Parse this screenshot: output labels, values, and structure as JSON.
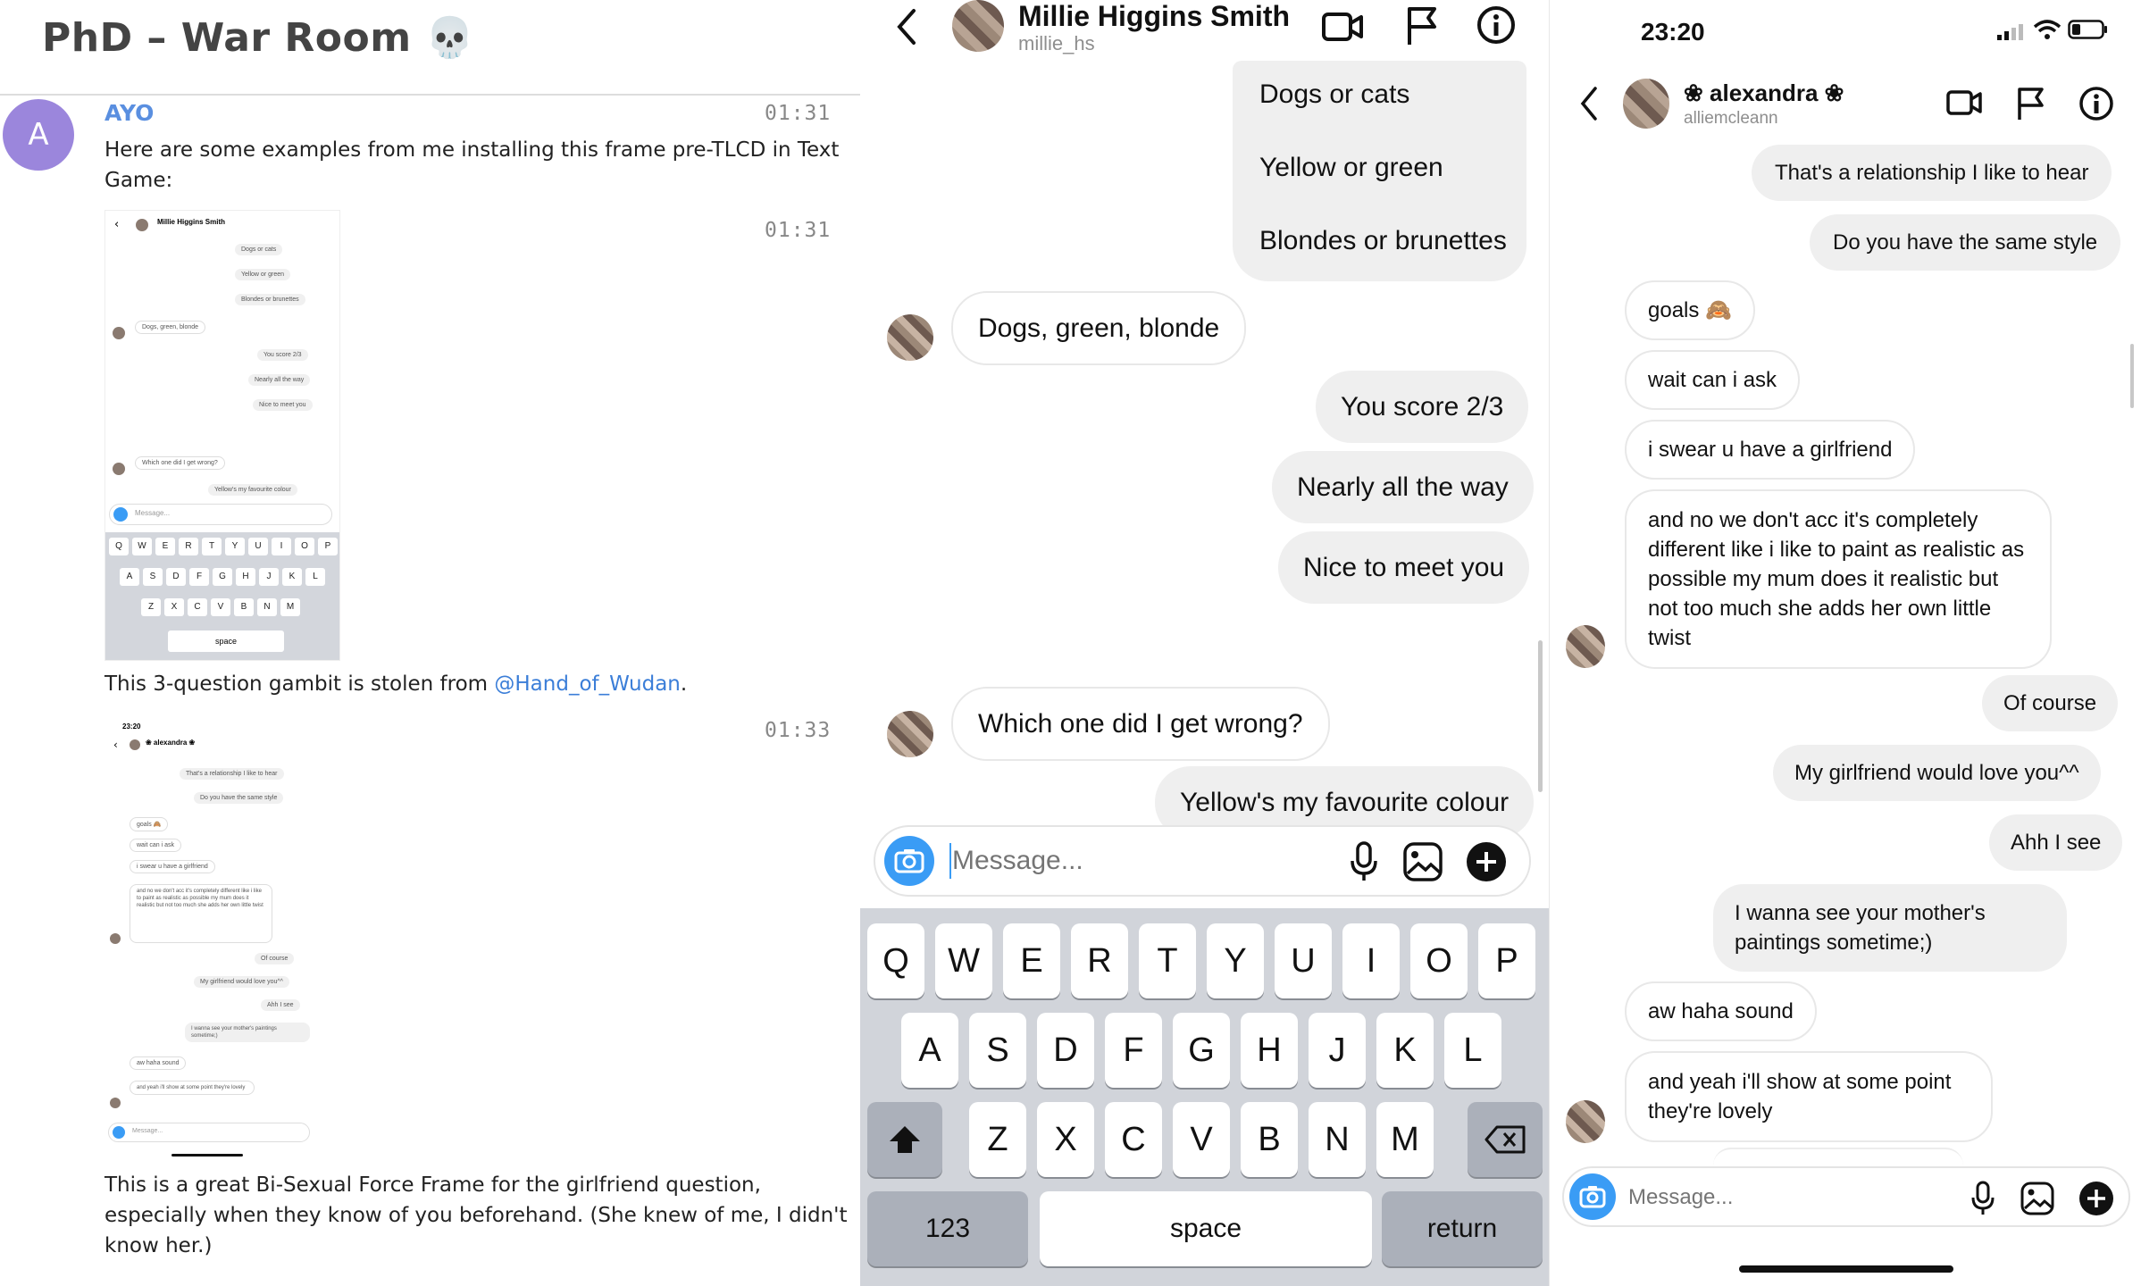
{
  "discord": {
    "room_title": "PhD – War Room 💀",
    "author_initial": "A",
    "author": "AYO",
    "ts1": "01:31",
    "ts2": "01:31",
    "ts3": "01:33",
    "text1": "Here are some examples from me installing this frame pre-TLCD in Text Game:",
    "text2_pre": "This 3-question gambit is stolen from ",
    "text2_mention": "@Hand_of_Wudan",
    "text2_post": ".",
    "text3": "This is a great Bi-Sexual Force Frame for the girlfriend question, especially when they know of you beforehand. (She knew of me, I didn't know her.)",
    "thumb1": {
      "name": "Millie Higgins Smith",
      "msgs": [
        "Dogs or cats",
        "Yellow or green",
        "Blondes or brunettes",
        "Dogs, green, blonde",
        "You score 2/3",
        "Nearly all the way",
        "Nice to meet you",
        "Which one did I get wrong?",
        "Yellow's my favourite colour"
      ],
      "placeholder": "Message..."
    },
    "thumb2": {
      "time": "23:20",
      "name": "❀ alexandra ❀",
      "msgs": [
        "That's a relationship I like to hear",
        "Do you have the same style",
        "goals 🙈",
        "wait can i ask",
        "i swear u have a girlfriend",
        "and no we don't acc it's completely different like i like to paint as realistic as possible my mum does it realistic but not too much she adds her own little twist",
        "Of course",
        "My girlfriend would love you^^",
        "Ahh I see",
        "I wanna see your mother's paintings sometime;)",
        "aw haha sound",
        "and yeah i'll show at some point they're lovely"
      ],
      "placeholder": "Message..."
    }
  },
  "chat1": {
    "name": "Millie Higgins Smith",
    "username": "millie_hs",
    "messages": {
      "m1": "Dogs or cats",
      "m2": "Yellow or green",
      "m3": "Blondes or brunettes",
      "m4": "Dogs, green, blonde",
      "m5": "You score 2/3",
      "m6": "Nearly all the way",
      "m7": "Nice to meet you",
      "m8": "Which one did I get wrong?",
      "m9": "Yellow's my favourite colour"
    },
    "placeholder": "Message...",
    "keys": {
      "row1": [
        "Q",
        "W",
        "E",
        "R",
        "T",
        "Y",
        "U",
        "I",
        "O",
        "P"
      ],
      "row2": [
        "A",
        "S",
        "D",
        "F",
        "G",
        "H",
        "J",
        "K",
        "L"
      ],
      "row3": [
        "Z",
        "X",
        "C",
        "V",
        "B",
        "N",
        "M"
      ],
      "k123": "123",
      "space": "space",
      "return": "return"
    }
  },
  "chat2": {
    "time": "23:20",
    "name": "❀ alexandra ❀",
    "username": "alliemcleann",
    "messages": {
      "m1": "That's a relationship I like to hear",
      "m2": "Do you have the same style",
      "m3": "goals 🙈",
      "m4": "wait can i ask",
      "m5": "i swear u have a girlfriend",
      "m6": "and no we don't acc it's completely different like i like to paint as realistic as possible my mum does it realistic but not too much she adds her own little twist",
      "m7": "Of course",
      "m8": "My girlfriend would love you^^",
      "m9": "Ahh I see",
      "m10": "I wanna see your mother's paintings sometime;)",
      "m11": "aw haha sound",
      "m12": "and yeah i'll show at some point they're lovely"
    },
    "placeholder": "Message..."
  },
  "colors": {
    "accent_blue": "#3a9cf5",
    "discord_avatar": "#9b86dc",
    "author": "#5a8fe0",
    "mention": "#3b7ed8"
  },
  "icons": [
    "back-chevron-icon",
    "video-call-icon",
    "flag-icon",
    "info-icon",
    "camera-icon",
    "microphone-icon",
    "gallery-icon",
    "plus-icon",
    "shift-icon",
    "backspace-icon",
    "signal-icon",
    "wifi-icon",
    "battery-icon",
    "skull-icon"
  ]
}
